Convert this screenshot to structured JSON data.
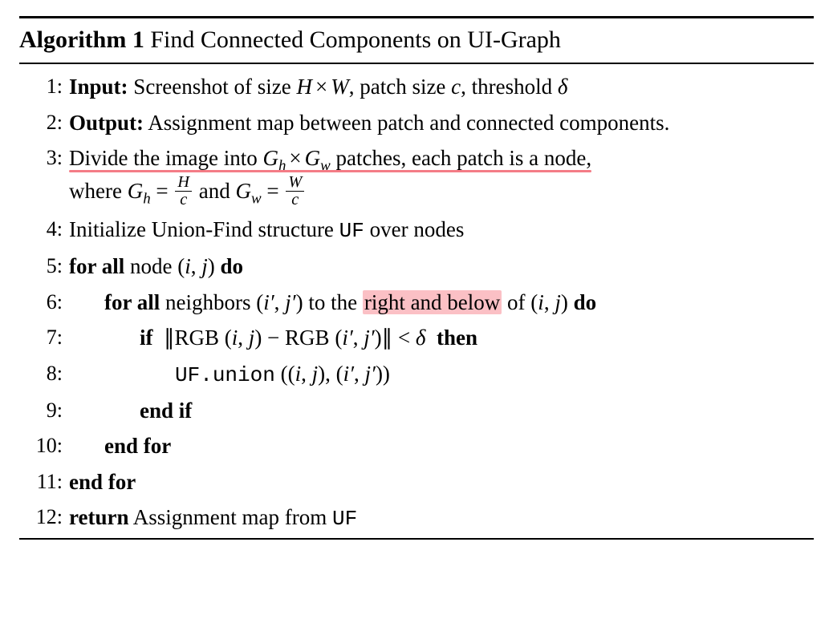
{
  "title": {
    "label": "Algorithm 1",
    "caption": "Find Connected Components on UI-Graph"
  },
  "kw": {
    "input": "Input:",
    "output": "Output:",
    "forall": "for all",
    "do": "do",
    "if": "if",
    "then": "then",
    "endif": "end if",
    "endfor": "end for",
    "return": "return"
  },
  "ln": {
    "l1": "1:",
    "l2": "2:",
    "l3": "3:",
    "l4": "4:",
    "l5": "5:",
    "l6": "6:",
    "l7": "7:",
    "l8": "8:",
    "l9": "9:",
    "l10": "10:",
    "l11": "11:",
    "l12": "12:"
  },
  "txt": {
    "l1a": "Screenshot of size ",
    "l1b": ", patch size ",
    "l1c": ", threshold ",
    "l2": "Assignment map between patch and connected components.",
    "l3a": "Divide the image into ",
    "l3b": " patches, each patch is a node,",
    "l3c": "where ",
    "l3d": " and ",
    "l4a": "Initialize Union-Find structure ",
    "l4b": " over nodes",
    "l5a": "node ",
    "l6a": "neighbors ",
    "l6b": " to the ",
    "l6hl": "right and below",
    "l6c": " of ",
    "l12a": "Assignment map from "
  },
  "sym": {
    "H": "H",
    "W": "W",
    "c": "c",
    "delta": "δ",
    "Gh": "G",
    "Gw": "G",
    "h": "h",
    "w": "w",
    "i": "i",
    "j": "j",
    "ip": "i′",
    "jp": "j′",
    "UF": "UF",
    "union": ".union",
    "RGB": "RGB",
    "lt": "<",
    "eq": "="
  },
  "highlight_color": "#f47c86"
}
